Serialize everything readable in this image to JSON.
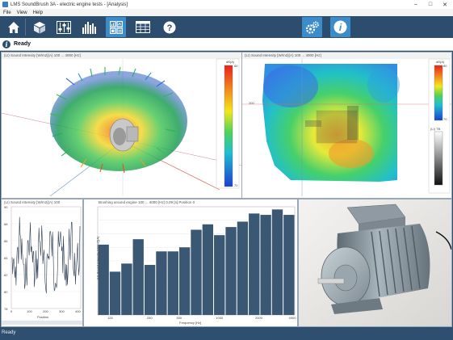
{
  "window": {
    "title": "LMS SoundBrush 3A - electric engine tests - [Analysis]"
  },
  "menu": [
    "File",
    "View",
    "Help"
  ],
  "status": {
    "text": "Ready",
    "footer_text": "Ready"
  },
  "toolbar": {
    "buttons": [
      {
        "name": "home-icon",
        "active": false
      },
      {
        "name": "cube-icon",
        "active": false
      },
      {
        "name": "sliders-icon",
        "active": false
      },
      {
        "name": "spectrum-icon",
        "active": false
      },
      {
        "name": "analysis-grid-icon",
        "active": true
      },
      {
        "name": "table-icon",
        "active": false
      },
      {
        "name": "help-icon",
        "active": false
      },
      {
        "name": "settings-gears-icon",
        "active": true
      },
      {
        "name": "info-icon",
        "active": true
      }
    ]
  },
  "panels": {
    "view3d": {
      "title": "(LI) Sound Intensity [W/m2](A)  100 ... 4000 [Hz]",
      "colorbar_unit": "dB(A)",
      "colorbar_ticks": [
        "80",
        "70"
      ]
    },
    "map2d": {
      "title": "(LI) Sound Intensity [W/m2](A)  100 ... 4000 [Hz]",
      "colorbar_unit": "dB(A)",
      "colorbar_ticks": [
        "80",
        "70"
      ],
      "tb_label": "(LI) TB",
      "tb_ticks": [
        "",
        ""
      ],
      "axis_mark": "300"
    },
    "timeplot": {
      "title": "(LI) Sound Intensity [W/m2](A)  100",
      "xlabel": "Position",
      "yticks": [
        "90",
        "88",
        "86",
        "84",
        "82",
        "80",
        "78"
      ],
      "xticks": [
        "0",
        "100",
        "200",
        "300",
        "400"
      ]
    },
    "photo": {
      "alt": "electric motor"
    }
  },
  "chart_data": {
    "type": "bar",
    "title": "Brushing around engine  100 ... 4000 [Hz]  0.09 [s]  Position 0",
    "xlabel": "Frequency [Hz]",
    "ylabel": "(LI) Sound Intensity [W/m2](A)",
    "xticks": [
      "125",
      "250",
      "500",
      "1000",
      "2000",
      "4000"
    ],
    "ytick_count": 8,
    "ylim": [
      0,
      80
    ],
    "values": [
      52,
      32,
      38,
      56,
      37,
      47,
      47,
      50,
      63,
      67,
      59,
      65,
      69,
      75,
      74,
      78,
      74
    ],
    "bar_color": "#3a5873"
  }
}
